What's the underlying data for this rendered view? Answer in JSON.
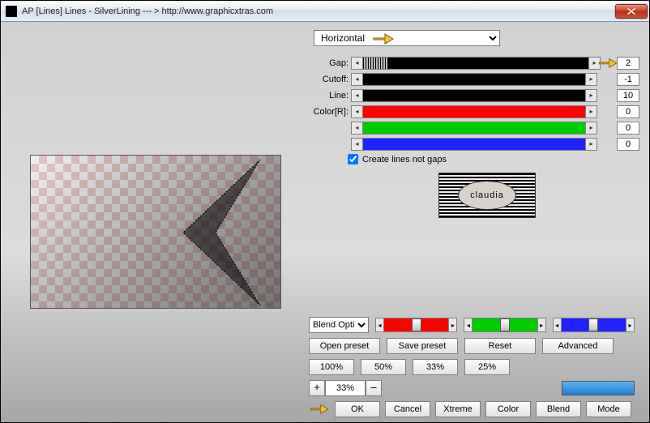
{
  "title": "AP [Lines]  Lines - SilverLining   --- > http://www.graphicxtras.com",
  "dropdown": {
    "selected": "Horizontal"
  },
  "sliders": {
    "gap": {
      "label": "Gap:",
      "value": "2"
    },
    "cutoff": {
      "label": "Cutoff:",
      "value": "-1"
    },
    "line": {
      "label": "Line:",
      "value": "10"
    },
    "colorR": {
      "label": "Color[R]:",
      "value": "0"
    },
    "colorG": {
      "label": "",
      "value": "0"
    },
    "colorB": {
      "label": "",
      "value": "0"
    }
  },
  "checkbox": {
    "label": "Create lines not gaps",
    "checked": true
  },
  "logo_text": "claudia",
  "blend_select": "Blend Options",
  "preset_buttons": {
    "open": "Open preset",
    "save": "Save preset",
    "reset": "Reset",
    "advanced": "Advanced"
  },
  "zoom_presets": [
    "100%",
    "50%",
    "33%",
    "25%"
  ],
  "zoom": {
    "plus": "+",
    "value": "33%",
    "minus": "–"
  },
  "bottom_buttons": [
    "OK",
    "Cancel",
    "Xtreme",
    "Color",
    "Blend",
    "Mode"
  ]
}
